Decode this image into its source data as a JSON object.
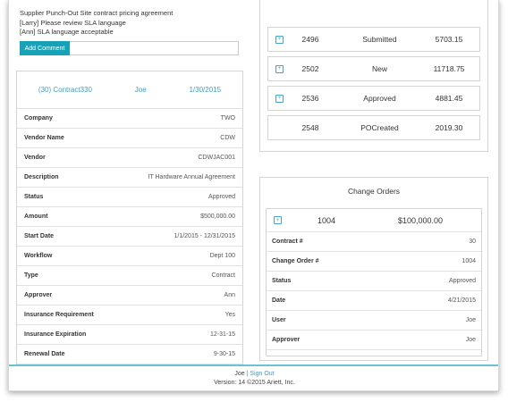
{
  "comments": [
    "Supplier Punch-Out Site contract pricing agreement",
    "[Larry] Please review SLA language",
    "[Ann] SLA language acceptable"
  ],
  "comment_input": {
    "placeholder": ""
  },
  "add_comment_label": "Add Comment",
  "contract_header": {
    "id": "(30) Contract330",
    "owner": "Joe",
    "date": "1/30/2015"
  },
  "contract_fields": [
    {
      "key": "Company",
      "value": "TWO"
    },
    {
      "key": "Vendor Name",
      "value": "CDW"
    },
    {
      "key": "Vendor",
      "value": "CDWJAC001"
    },
    {
      "key": "Description",
      "value": "IT Hardware Annual Agreement"
    },
    {
      "key": "Status",
      "value": "Approved"
    },
    {
      "key": "Amount",
      "value": "$500,000.00"
    },
    {
      "key": "Start Date",
      "value": "1/1/2015 - 12/31/2015"
    },
    {
      "key": "Workflow",
      "value": "Dept 100"
    },
    {
      "key": "Type",
      "value": "Contract"
    },
    {
      "key": "Approver",
      "value": "Ann"
    },
    {
      "key": "Insurance Requirement",
      "value": "Yes"
    },
    {
      "key": "Insurance Expiration",
      "value": "12-31-15"
    },
    {
      "key": "Renewal Date",
      "value": "9-30-15"
    }
  ],
  "orders": [
    {
      "number": "2496",
      "status": "Submitted",
      "amount": "5703.15",
      "has_icon": true
    },
    {
      "number": "2502",
      "status": "New",
      "amount": "11718.75",
      "has_icon": true
    },
    {
      "number": "2536",
      "status": "Approved",
      "amount": "4881.45",
      "has_icon": true
    },
    {
      "number": "2548",
      "status": "POCreated",
      "amount": "2019.30",
      "has_icon": false
    }
  ],
  "change_orders": {
    "title": "Change Orders",
    "summary": {
      "number": "1004",
      "amount": "$100,000.00"
    },
    "fields": [
      {
        "key": "Contract #",
        "value": "30"
      },
      {
        "key": "Change Order #",
        "value": "1004"
      },
      {
        "key": "Status",
        "value": "Approved"
      },
      {
        "key": "Date",
        "value": "4/21/2015"
      },
      {
        "key": "User",
        "value": "Joe"
      },
      {
        "key": "Approver",
        "value": "Joe"
      }
    ]
  },
  "footer": {
    "user": "Joe",
    "separator": "|",
    "sign_out": "Sign Out",
    "version": "Version: 14 ©2015 Ariett, Inc."
  },
  "colors": {
    "accent": "#17a2b8",
    "link": "#3a9fc1",
    "footer_line": "#6bc3cf"
  }
}
